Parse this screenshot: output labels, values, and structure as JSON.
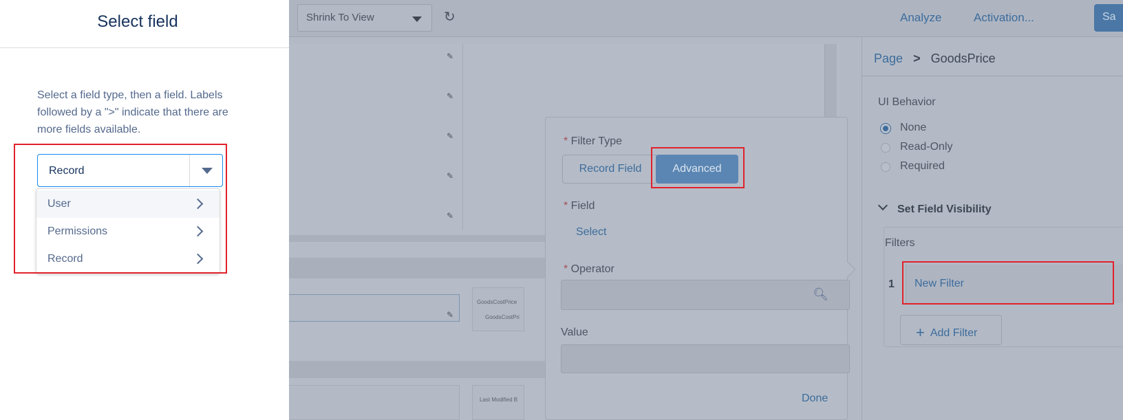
{
  "drawer": {
    "title": "Select field",
    "help_text": "Select a field type, then a field. Labels followed by a \">\" indicate that there are more fields available.",
    "combobox_value": "Record",
    "options": [
      {
        "label": "User"
      },
      {
        "label": "Permissions"
      },
      {
        "label": "Record"
      }
    ]
  },
  "toolbar": {
    "view_select": "Shrink To View",
    "refresh_icon": "refresh-icon",
    "analyze": "Analyze",
    "activation": "Activation...",
    "save": "Sa"
  },
  "canvas": {
    "field1_label": "GoodsCostPrice",
    "field1_value": "GoodsCostPri",
    "field2_label": "Last Modified B"
  },
  "filter_popover": {
    "filter_type_label": "Filter Type",
    "record_field": "Record Field",
    "advanced": "Advanced",
    "field_label": "Field",
    "field_select": "Select",
    "operator_label": "Operator",
    "value_label": "Value",
    "done": "Done"
  },
  "properties": {
    "breadcrumb_page": "Page",
    "breadcrumb_sep": ">",
    "breadcrumb_current": "GoodsPrice",
    "ui_behavior_label": "UI Behavior",
    "ui_behavior_options": [
      "None",
      "Read-Only",
      "Required"
    ],
    "selected_behavior": "None",
    "set_visibility": "Set Field Visibility",
    "filters_label": "Filters",
    "filter_number": "1",
    "filter_name": "New Filter",
    "add_filter": "Add Filter"
  },
  "colors": {
    "accent": "#1589ee",
    "highlight": "#e0222b",
    "title": "#16325c"
  }
}
